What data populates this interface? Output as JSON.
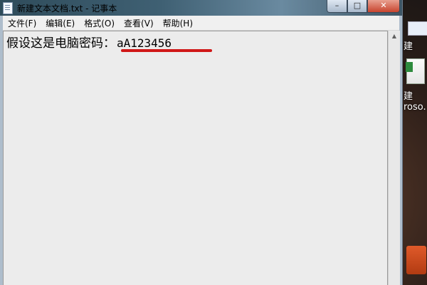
{
  "window": {
    "title": "新建文本文档.txt - 记事本",
    "caption_buttons": {
      "minimize": "–",
      "maximize": "□",
      "close": "✕"
    }
  },
  "menu": {
    "items": [
      "文件(F)",
      "编辑(E)",
      "格式(O)",
      "查看(V)",
      "帮助(H)"
    ]
  },
  "editor": {
    "text_prefix": "假设这是电脑密码：",
    "password": "aA123456",
    "underline_color": "#d01818"
  },
  "scrollbar": {
    "up_arrow": "▲"
  },
  "desktop": {
    "icons": [
      {
        "label": "建",
        "icon": "document-icon"
      },
      {
        "label": "建\nroso.",
        "icon": "spreadsheet-icon"
      },
      {
        "label": "",
        "icon": "office-icon"
      }
    ]
  }
}
